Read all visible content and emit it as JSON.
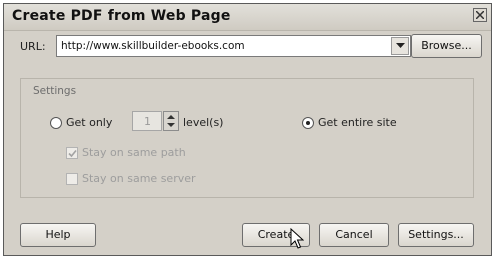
{
  "window": {
    "title": "Create PDF from Web Page"
  },
  "url": {
    "label": "URL:",
    "value": "http://www.skillbuilder-ebooks.com",
    "browse_label": "Browse..."
  },
  "settings": {
    "group_label": "Settings",
    "get_only_label": "Get only",
    "levels_value": "1",
    "levels_label": "level(s)",
    "get_entire_site_label": "Get entire site",
    "selected_option": "Get entire site",
    "stay_same_path_label": "Stay on same path",
    "stay_same_path_checked": true,
    "stay_same_server_label": "Stay on same server",
    "stay_same_server_checked": false
  },
  "buttons": {
    "help": "Help",
    "create": "Create",
    "cancel": "Cancel",
    "settings": "Settings..."
  },
  "icons": [
    "close-icon",
    "chevron-down-icon",
    "spinner-arrows-icon",
    "checkmark-icon",
    "mouse-pointer-icon"
  ]
}
